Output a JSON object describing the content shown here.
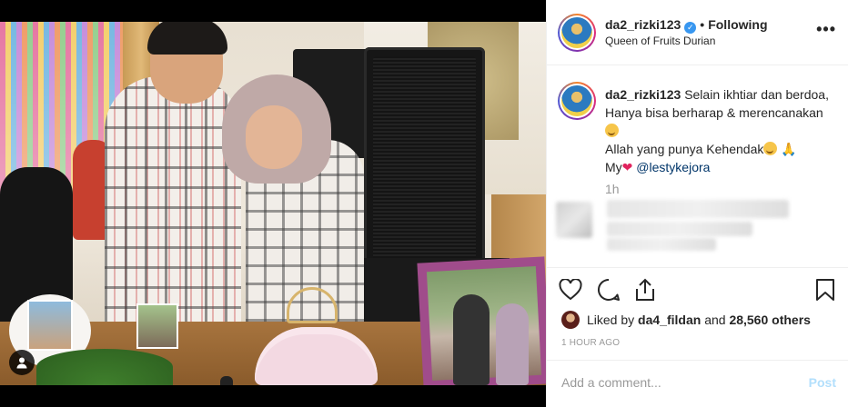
{
  "post": {
    "username": "da2_rizki123",
    "verified": true,
    "follow_status": "Following",
    "separator": "•",
    "location": "Queen of Fruits Durian",
    "more_icon": "more-horizontal-icon"
  },
  "caption": {
    "username": "da2_rizki123",
    "line1": "Selain ikhtiar dan berdoa, Hanya bisa berharap & merencanakan",
    "line2": "Allah yang punya Kehendak",
    "line3_prefix": "My",
    "mention": "@lestykejora",
    "time": "1h"
  },
  "actions": {
    "like_icon": "heart-outline-icon",
    "comment_icon": "comment-icon",
    "share_icon": "share-icon",
    "save_icon": "bookmark-icon"
  },
  "likes": {
    "prefix": "Liked by",
    "user": "da4_fildan",
    "joiner": "and",
    "count_text": "28,560 others"
  },
  "timestamp": "1 HOUR AGO",
  "comment": {
    "placeholder": "Add a comment...",
    "post_label": "Post"
  },
  "colors": {
    "link": "#003569",
    "verified": "#3897f0",
    "post_disabled": "#b2dffc",
    "muted": "#999999"
  }
}
